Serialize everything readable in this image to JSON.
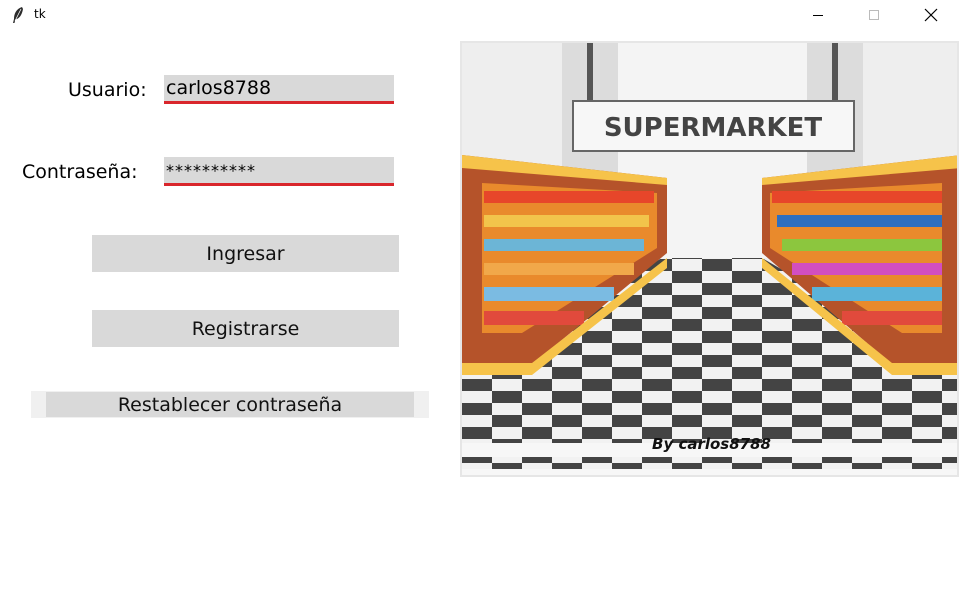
{
  "window": {
    "title": "tk",
    "app_icon": "feather-icon",
    "controls": [
      "minimize-icon",
      "maximize-icon",
      "close-icon"
    ]
  },
  "form": {
    "user_label": "Usuario:",
    "user_value": "carlos8788",
    "password_label": "Contraseña:",
    "password_value": "**********"
  },
  "buttons": {
    "login": "Ingresar",
    "register": "Registrarse",
    "reset": "Restablecer contraseña"
  },
  "image": {
    "sign_text": "SUPERMARKET",
    "byline": "By carlos8788"
  },
  "colors": {
    "entry_bg": "#d9d9d9",
    "entry_underline": "#d9262c",
    "button_bg": "#d9d9d9"
  }
}
